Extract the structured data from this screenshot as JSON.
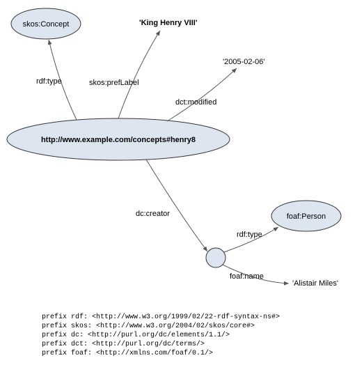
{
  "nodes": {
    "concept_class": {
      "label": "skos:Concept"
    },
    "main": {
      "label": "http://www.example.com/concepts#henry8"
    },
    "person_class": {
      "label": "foaf:Person"
    },
    "blank": {}
  },
  "literals": {
    "prefLabel": "'King Henry VIII'",
    "modified": "'2005-02-06'",
    "name": "'Alistair Miles'"
  },
  "edges": {
    "type1": "rdf:type",
    "prefLabel": "skos:prefLabel",
    "modified": "dct:modified",
    "creator": "dc:creator",
    "type2": "rdf:type",
    "name": "foaf:name"
  },
  "prefixes": [
    "prefix rdf: <http://www.w3.org/1999/02/22-rdf-syntax-ns#>",
    "prefix skos: <http://www.w3.org/2004/02/skos/core#>",
    "prefix dc: <http://purl.org/dc/elements/1.1/>",
    "prefix dct: <http://purl.org/dc/terms/>",
    "prefix foaf: <http://xmlns.com/foaf/0.1/>"
  ]
}
